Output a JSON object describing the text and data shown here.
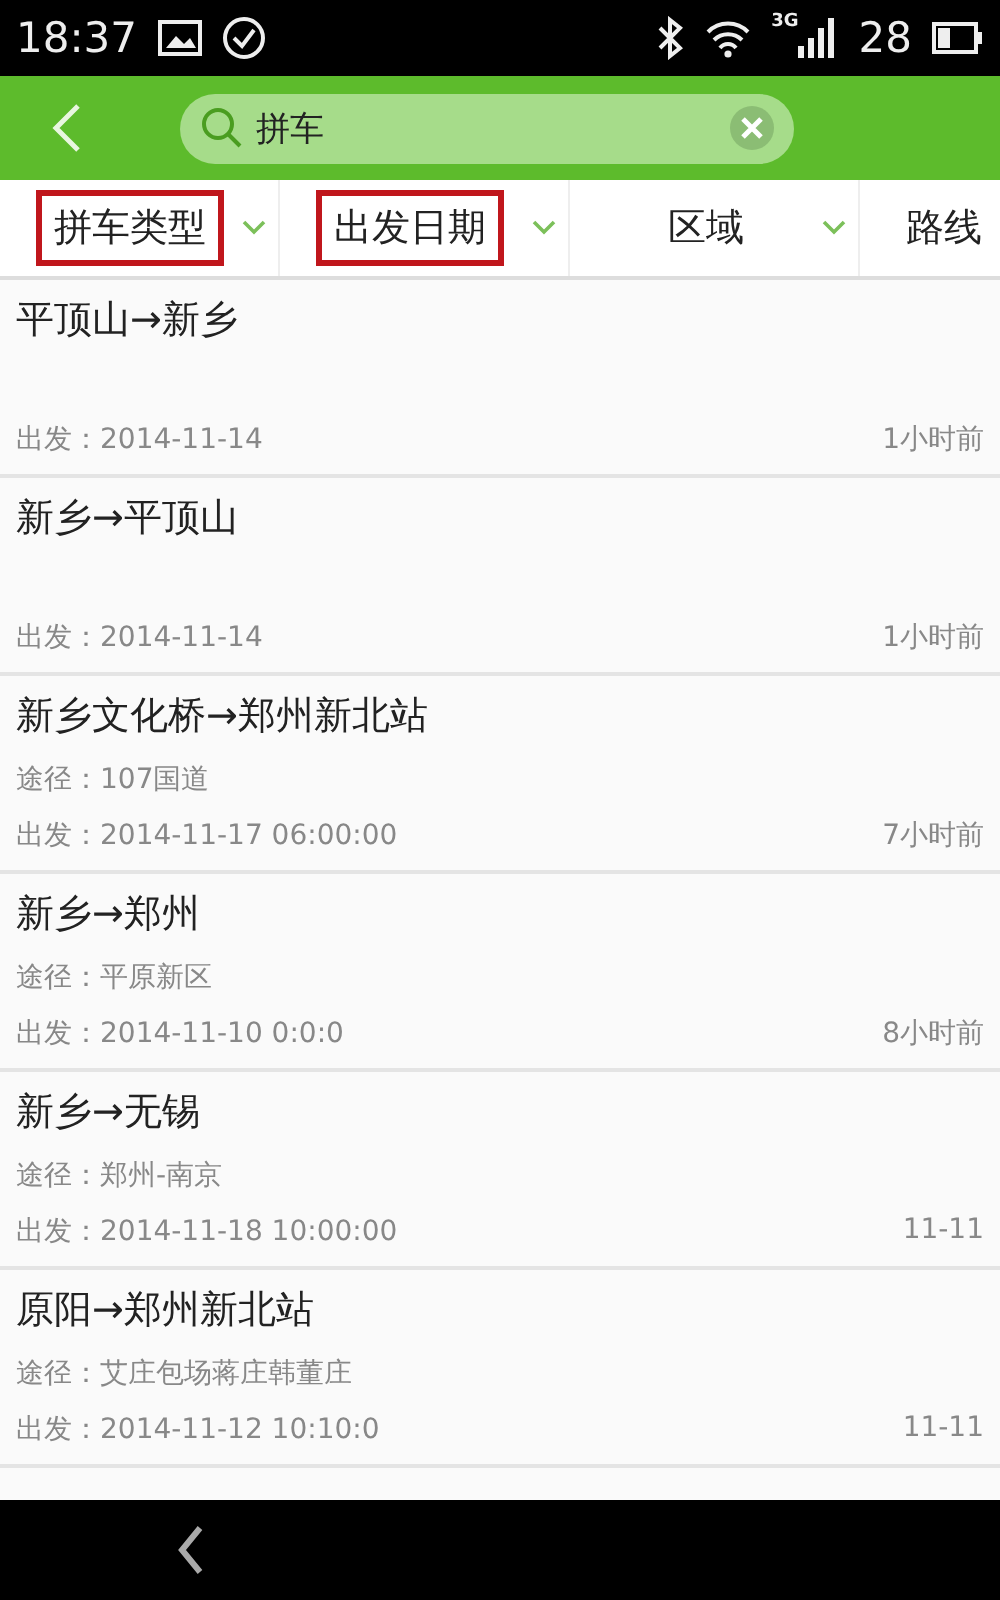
{
  "status_bar": {
    "time": "18:37",
    "network": "3G",
    "battery": "28"
  },
  "search": {
    "value": "拼车"
  },
  "filters": [
    {
      "label": "拼车类型",
      "highlighted": true,
      "dropdown": true
    },
    {
      "label": "出发日期",
      "highlighted": true,
      "dropdown": true
    },
    {
      "label": "区域",
      "highlighted": false,
      "dropdown": true
    },
    {
      "label": "路线",
      "highlighted": false,
      "dropdown": false
    }
  ],
  "rides": [
    {
      "route": "平顶山→新乡",
      "departure": "出发：2014-11-14",
      "posted": "1小时前"
    },
    {
      "route": "新乡→平顶山",
      "departure": "出发：2014-11-14",
      "posted": "1小时前"
    },
    {
      "route": "新乡文化桥→郑州新北站",
      "via": "途径：107国道",
      "departure": "出发：2014-11-17 06:00:00",
      "posted": "7小时前"
    },
    {
      "route": "新乡→郑州",
      "via": "途径：平原新区",
      "departure": "出发：2014-11-10 0:0:0",
      "posted": "8小时前"
    },
    {
      "route": "新乡→无锡",
      "via": "途径：郑州-南京",
      "departure": "出发：2014-11-18 10:00:00",
      "posted": "11-11"
    },
    {
      "route": "原阳→郑州新北站",
      "via": "途径：艾庄包场蒋庄韩董庄",
      "departure": "出发：2014-11-12 10:10:0",
      "posted": "11-11"
    }
  ]
}
